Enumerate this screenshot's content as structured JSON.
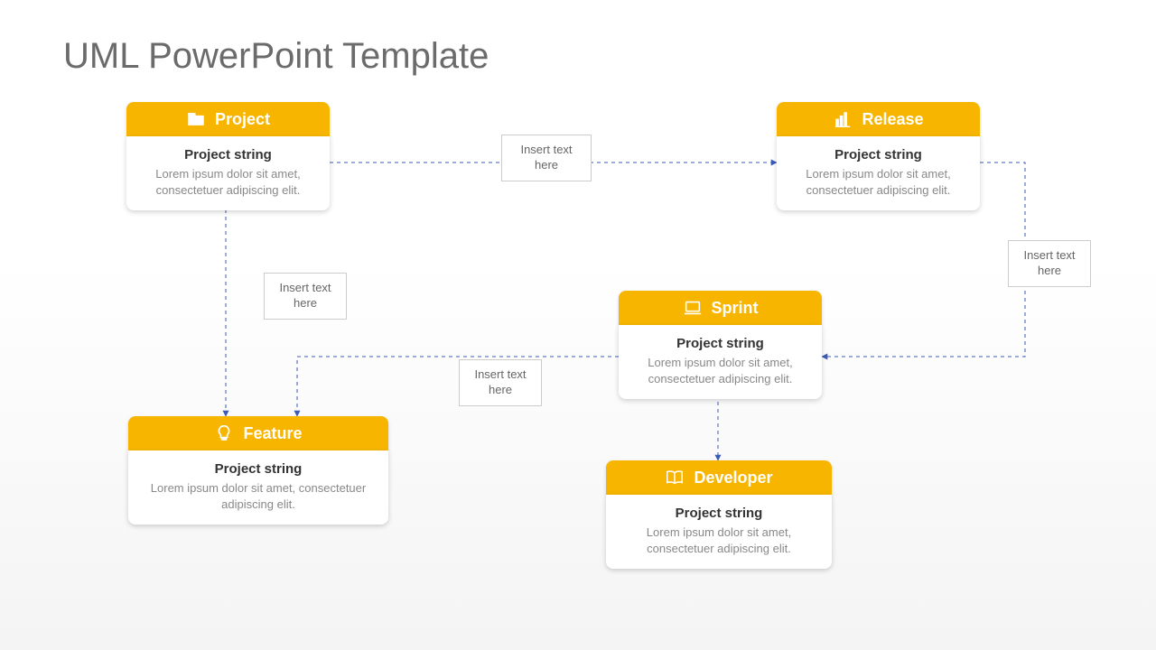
{
  "title": "UML PowerPoint Template",
  "colors": {
    "accent": "#f7b500"
  },
  "nodes": {
    "project": {
      "label": "Project",
      "subtitle": "Project string",
      "desc": "Lorem ipsum dolor sit amet, consectetuer adipiscing elit."
    },
    "release": {
      "label": "Release",
      "subtitle": "Project string",
      "desc": "Lorem ipsum dolor sit amet, consectetuer adipiscing elit."
    },
    "sprint": {
      "label": "Sprint",
      "subtitle": "Project string",
      "desc": "Lorem ipsum dolor sit amet, consectetuer adipiscing elit."
    },
    "feature": {
      "label": "Feature",
      "subtitle": "Project string",
      "desc": "Lorem ipsum dolor sit amet, consectetuer adipiscing elit."
    },
    "developer": {
      "label": "Developer",
      "subtitle": "Project string",
      "desc": "Lorem ipsum dolor sit amet, consectetuer adipiscing elit."
    }
  },
  "edge_labels": {
    "project_release": "Insert text here",
    "project_feature": "Insert text here",
    "release_sprint": "Insert text here",
    "sprint_feature": "Insert text here"
  }
}
